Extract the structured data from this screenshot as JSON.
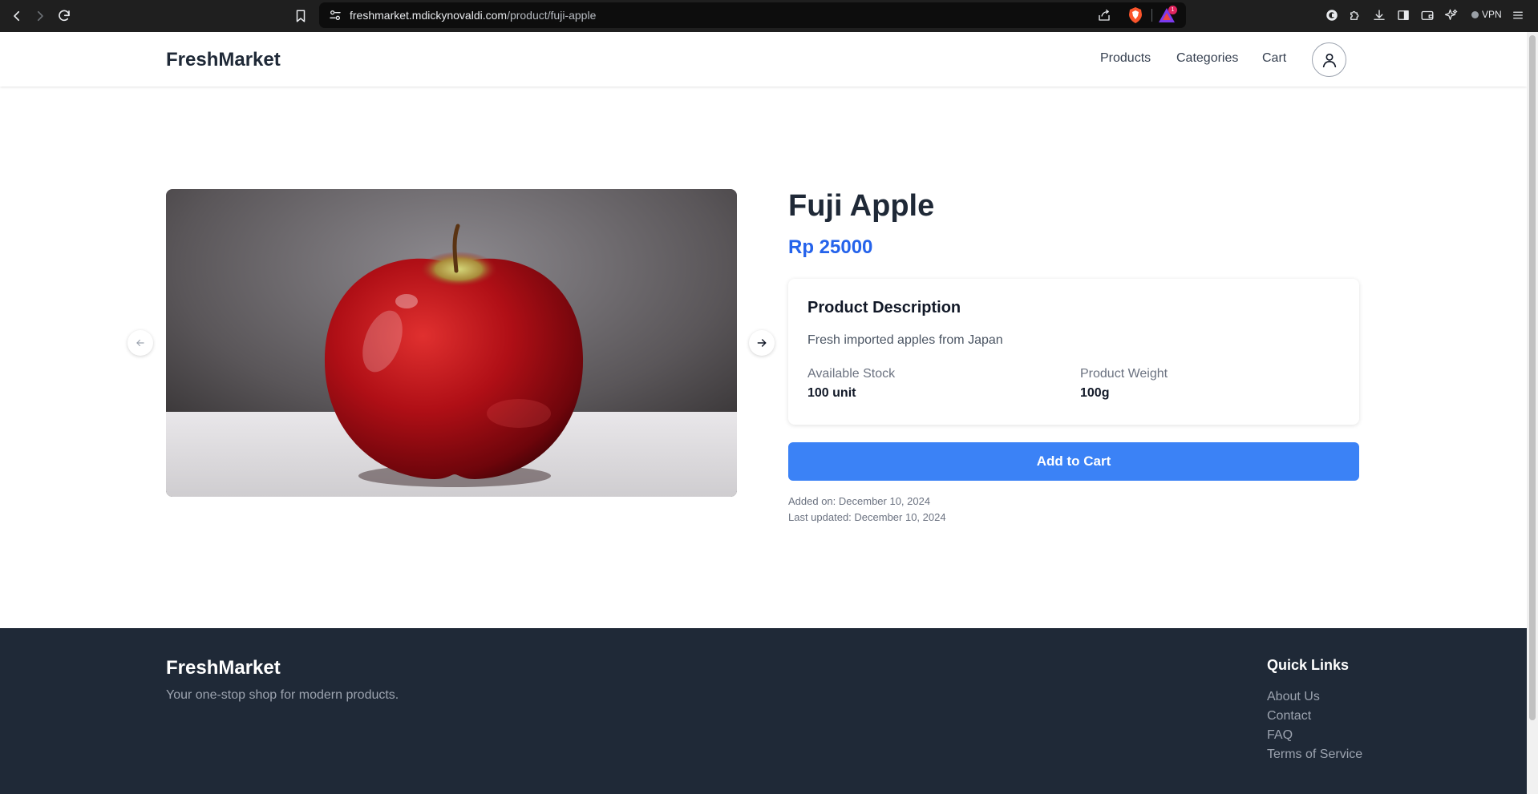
{
  "browser": {
    "url_domain": "freshmarket.mdickynovaldi.com",
    "url_path": "/product/fuji-apple",
    "vpn_label": "VPN",
    "rewards_count": "1"
  },
  "header": {
    "logo": "FreshMarket",
    "nav": [
      "Products",
      "Categories",
      "Cart"
    ]
  },
  "product": {
    "title": "Fuji Apple",
    "price": "Rp 25000",
    "description_heading": "Product Description",
    "description": "Fresh imported apples from Japan",
    "stock_label": "Available Stock",
    "stock_value": "100 unit",
    "weight_label": "Product Weight",
    "weight_value": "100g",
    "add_to_cart_label": "Add to Cart",
    "added_on": "Added on: December 10, 2024",
    "last_updated": "Last updated: December 10, 2024"
  },
  "footer": {
    "logo": "FreshMarket",
    "tagline": "Your one-stop shop for modern products.",
    "quick_links_heading": "Quick Links",
    "links": [
      "About Us",
      "Contact",
      "FAQ",
      "Terms of Service"
    ]
  },
  "colors": {
    "accent": "#3b82f6",
    "price": "#2563eb",
    "footer_bg": "#1f2937"
  }
}
